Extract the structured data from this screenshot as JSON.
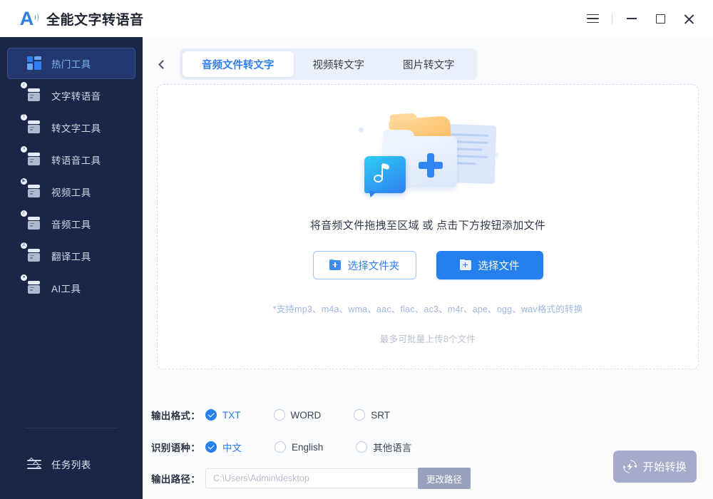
{
  "titlebar": {
    "app_title": "全能文字转语音",
    "logo_letter": "A",
    "menu_icon": "hamburger-menu-icon",
    "minimize_icon": "minimize-icon",
    "maximize_icon": "maximize-icon",
    "close_icon": "close-icon"
  },
  "sidebar": {
    "items": [
      {
        "label": "热门工具",
        "icon": "grid-dashboard-icon",
        "active": true
      },
      {
        "label": "文字转语音",
        "icon": "card-stack-icon"
      },
      {
        "label": "转文字工具",
        "icon": "card-stack-icon"
      },
      {
        "label": "转语音工具",
        "icon": "card-stack-icon"
      },
      {
        "label": "视频工具",
        "icon": "card-stack-icon"
      },
      {
        "label": "音频工具",
        "icon": "card-stack-icon"
      },
      {
        "label": "翻译工具",
        "icon": "card-stack-icon"
      },
      {
        "label": "AI工具",
        "icon": "card-stack-icon"
      }
    ],
    "bottom": {
      "label": "任务列表",
      "icon": "sliders-icon"
    }
  },
  "main": {
    "back_icon": "chevron-left-icon",
    "tabs": [
      {
        "label": "音频文件转文字",
        "active": true
      },
      {
        "label": "视频转文字",
        "active": false
      },
      {
        "label": "图片转文字",
        "active": false
      }
    ],
    "dropzone": {
      "illustration": "folder-music-add-illustration",
      "title": "将音频文件拖拽至区域 或 点击下方按钮添加文件",
      "folder_button": "选择文件夹",
      "file_button": "选择文件",
      "folder_button_icon": "folder-add-icon",
      "file_button_icon": "file-add-icon",
      "format_hint": "*支持mp3、m4a、wma、aac、flac、ac3、m4r、ape、ogg、wav格式的转换",
      "limit_hint": "最多可批量上传8个文件"
    },
    "options": {
      "output_format": {
        "label": "输出格式：",
        "choices": [
          {
            "label": "TXT",
            "selected": true
          },
          {
            "label": "WORD",
            "selected": false
          },
          {
            "label": "SRT",
            "selected": false
          }
        ]
      },
      "language": {
        "label": "识别语种：",
        "choices": [
          {
            "label": "中文",
            "selected": true
          },
          {
            "label": "English",
            "selected": false
          },
          {
            "label": "其他语言",
            "selected": false
          }
        ]
      },
      "output_path": {
        "label": "输出路径：",
        "value": "",
        "placeholder": "C:\\Users\\Admin\\desktop",
        "change_button": "更改路径"
      }
    },
    "start_button": {
      "label": "开始转换",
      "icon": "convert-bolt-icon",
      "disabled": true
    }
  },
  "colors": {
    "sidebar_bg": "#1b2547",
    "sidebar_active_bg": "#23386e",
    "accent_blue": "#2680eb",
    "tab_strip_bg": "#eaf0fb",
    "main_bg": "#fafbfd",
    "disabled_button": "#a6aacb",
    "path_button": "#9aa1bd"
  }
}
